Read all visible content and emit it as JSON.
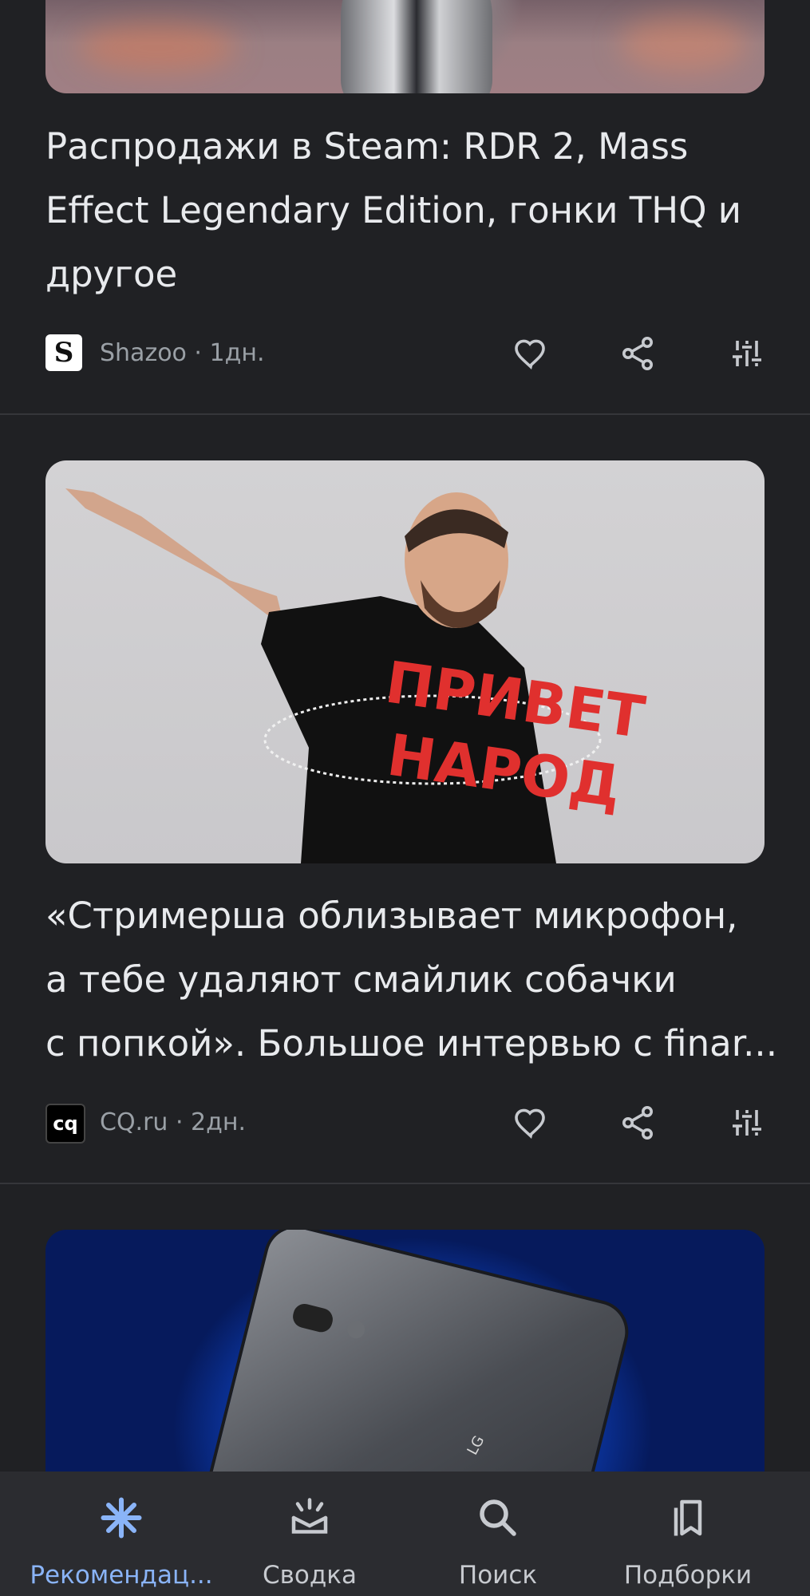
{
  "articles": [
    {
      "title": "Распродажи в Steam: RDR 2, Mass Effect Legendary Edition, гонки THQ и другое",
      "source": "Shazoo · 1дн.",
      "logo": "S"
    },
    {
      "title": "«Стримерша облизывает микрофон,\nа тебе удаляют смайлик собачки\nс попкой». Большое интервью с finar...",
      "source": "CQ.ru · 2дн.",
      "logo": "cq",
      "image_text": "ПРИВЕТ НАРОД"
    },
    {
      "image_text": "LG"
    }
  ],
  "bottom_nav": [
    {
      "label": "Рекомендац...",
      "icon": "sparkle-icon",
      "active": true
    },
    {
      "label": "Сводка",
      "icon": "briefing-icon",
      "active": false
    },
    {
      "label": "Поиск",
      "icon": "search-icon",
      "active": false
    },
    {
      "label": "Подборки",
      "icon": "collections-icon",
      "active": false
    }
  ],
  "colors": {
    "background": "#202124",
    "accent": "#8ab4f8",
    "text": "#e8eaed",
    "secondary_text": "#9aa0a6"
  }
}
